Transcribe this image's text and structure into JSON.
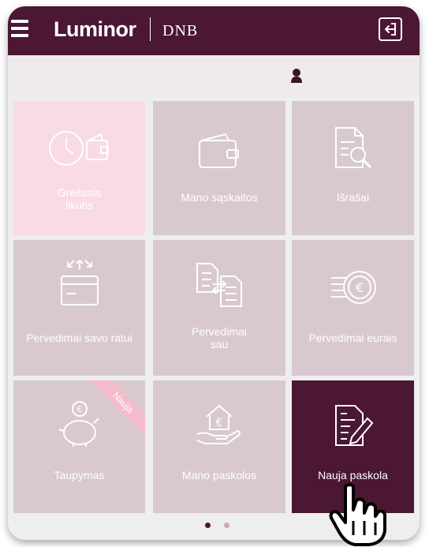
{
  "header": {
    "logo_main": "Luminor",
    "logo_partner": "DNB"
  },
  "tiles": [
    {
      "label": "Greitasis\nlikutis",
      "icon": "clock-wallet-icon"
    },
    {
      "label": "Mano sąskaitos",
      "icon": "wallet-icon"
    },
    {
      "label": "Išrašai",
      "icon": "document-search-icon"
    },
    {
      "label": "Pervedimai savo ratui",
      "icon": "card-transfer-icon"
    },
    {
      "label": "Pervedimai\nsau",
      "icon": "documents-transfer-icon"
    },
    {
      "label": "Pervedimai eurais",
      "icon": "euro-coin-icon"
    },
    {
      "label": "Taupymas",
      "icon": "piggy-bank-icon",
      "badge": "Nauja"
    },
    {
      "label": "Mano paskolos",
      "icon": "house-hand-icon"
    },
    {
      "label": "Nauja paskola",
      "icon": "document-pen-icon"
    }
  ],
  "pager": {
    "pages": 2,
    "active": 1
  },
  "colors": {
    "brand": "#4b1732",
    "tile": "#d8c9d0",
    "tile_highlight": "#f8dbe3",
    "badge": "#f4bcca",
    "background": "#eeeeee"
  }
}
